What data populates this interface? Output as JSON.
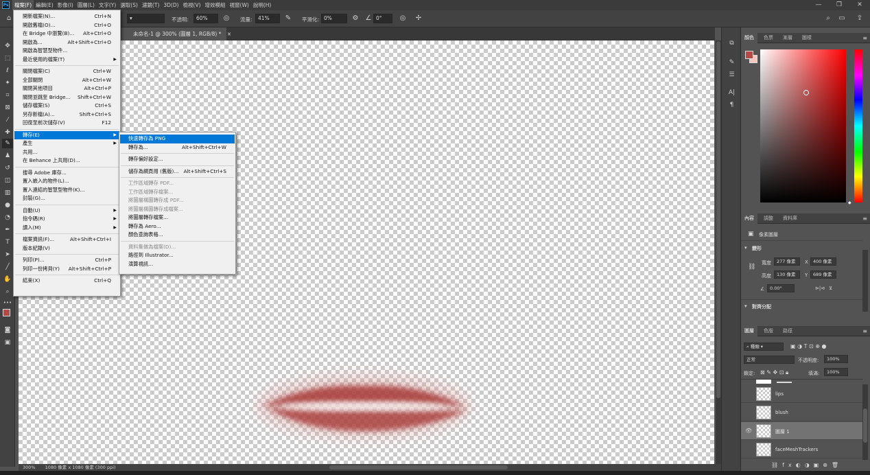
{
  "app": {
    "logo": "Ps"
  },
  "menubar": [
    {
      "label": "檔案(F)",
      "active": true
    },
    {
      "label": "編輯(E)"
    },
    {
      "label": "影像(I)"
    },
    {
      "label": "圖層(L)"
    },
    {
      "label": "文字(Y)"
    },
    {
      "label": "選取(S)"
    },
    {
      "label": "濾鏡(T)"
    },
    {
      "label": "3D(D)"
    },
    {
      "label": "檢視(V)"
    },
    {
      "label": "增效模組"
    },
    {
      "label": "視窗(W)"
    },
    {
      "label": "說明(H)"
    }
  ],
  "window_controls": {
    "minimize": "—",
    "restore": "❐",
    "close": "✕"
  },
  "options": {
    "opacity_label": "不透明:",
    "opacity_value": "60%",
    "flow_label": "流量:",
    "flow_value": "41%",
    "smoothing_label": "平滑化:",
    "smoothing_value": "0%",
    "angle_value": "0°"
  },
  "document": {
    "tab_title": "未命名-1 @ 300% (圖層 1, RGB/8) *",
    "close": "×"
  },
  "status": {
    "zoom": "300%",
    "size": "1080 像素 x 1080 像素 (300 ppi)"
  },
  "color_panel": {
    "tabs": [
      "顏色",
      "色票",
      "漸層",
      "圖樣"
    ],
    "foreground": "#b34a45",
    "background": "#f5c5bf"
  },
  "properties_panel": {
    "tabs": [
      "內容",
      "調整",
      "資料庫"
    ],
    "layer_type": "像素圖層",
    "transform_title": "變形",
    "w_label": "寬度",
    "w_value": "277 像素",
    "h_label": "高度",
    "h_value": "130 像素",
    "x_label": "X",
    "x_value": "400 像素",
    "y_label": "Y",
    "y_value": "689 像素",
    "angle_value": "0.00°",
    "align_title": "對齊分配"
  },
  "layers_panel": {
    "tabs": [
      "圖層",
      "色版",
      "路徑"
    ],
    "filter_kind": "種類",
    "blend_mode": "正常",
    "opacity_label": "不透明度:",
    "opacity_value": "100%",
    "lock_label": "鎖定:",
    "fill_label": "填滿:",
    "fill_value": "100%",
    "layers": [
      {
        "name": "lips",
        "visible": false,
        "selected": false
      },
      {
        "name": "blush",
        "visible": false,
        "selected": false
      },
      {
        "name": "圖層 1",
        "visible": true,
        "selected": true
      },
      {
        "name": "faceMeshTrackers",
        "visible": false,
        "selected": false
      }
    ]
  },
  "file_menu": [
    {
      "label": "開新檔案(N)...",
      "shortcut": "Ctrl+N"
    },
    {
      "label": "開啟舊檔(O)...",
      "shortcut": "Ctrl+O"
    },
    {
      "label": "在 Bridge 中瀏覽(B)...",
      "shortcut": "Alt+Ctrl+O"
    },
    {
      "label": "開啟為...",
      "shortcut": "Alt+Shift+Ctrl+O"
    },
    {
      "label": "開啟為智慧型物件..."
    },
    {
      "label": "最近使用的檔案(T)",
      "submenu": true
    },
    {
      "sep": true
    },
    {
      "label": "關閉檔案(C)",
      "shortcut": "Ctrl+W"
    },
    {
      "label": "全部關閉",
      "shortcut": "Alt+Ctrl+W"
    },
    {
      "label": "關閉其他項目",
      "shortcut": "Alt+Ctrl+P"
    },
    {
      "label": "關閉並跳至 Bridge...",
      "shortcut": "Shift+Ctrl+W"
    },
    {
      "label": "儲存檔案(S)",
      "shortcut": "Ctrl+S"
    },
    {
      "label": "另存新檔(A)...",
      "shortcut": "Shift+Ctrl+S"
    },
    {
      "label": "回復至前次儲存(V)",
      "shortcut": "F12"
    },
    {
      "sep": true
    },
    {
      "label": "轉存(E)",
      "submenu": true,
      "highlight": true
    },
    {
      "label": "產生",
      "submenu": true
    },
    {
      "label": "共用..."
    },
    {
      "label": "在 Behance 上共用(D)..."
    },
    {
      "sep": true
    },
    {
      "label": "搜尋 Adobe 庫存..."
    },
    {
      "label": "置入嵌入的物件(L)..."
    },
    {
      "label": "置入連結的智慧型物件(K)..."
    },
    {
      "label": "封裝(G)..."
    },
    {
      "sep": true
    },
    {
      "label": "自動(U)",
      "submenu": true
    },
    {
      "label": "指令碼(R)",
      "submenu": true
    },
    {
      "label": "讀入(M)",
      "submenu": true
    },
    {
      "sep": true
    },
    {
      "label": "檔案資訊(F)...",
      "shortcut": "Alt+Shift+Ctrl+I"
    },
    {
      "label": "版本紀錄(V)"
    },
    {
      "sep": true
    },
    {
      "label": "列印(P)...",
      "shortcut": "Ctrl+P"
    },
    {
      "label": "列印一份拷貝(Y)",
      "shortcut": "Alt+Shift+Ctrl+P"
    },
    {
      "sep": true
    },
    {
      "label": "結束(X)",
      "shortcut": "Ctrl+Q"
    }
  ],
  "export_menu": [
    {
      "label": "快速轉存為 PNG",
      "highlight": true
    },
    {
      "label": "轉存為...",
      "shortcut": "Alt+Shift+Ctrl+W"
    },
    {
      "sep": true
    },
    {
      "label": "轉存偏好設定..."
    },
    {
      "sep": true
    },
    {
      "label": "儲存為網頁用 (舊版)...",
      "shortcut": "Alt+Shift+Ctrl+S"
    },
    {
      "sep": true
    },
    {
      "label": "工作區域轉存 PDF...",
      "disabled": true
    },
    {
      "label": "工作區域轉存檔案...",
      "disabled": true
    },
    {
      "label": "將圖層構圖轉存成 PDF...",
      "disabled": true
    },
    {
      "label": "將圖層構圖轉存成檔案...",
      "disabled": true
    },
    {
      "label": "將圖層轉存檔案..."
    },
    {
      "label": "轉存為 Aero..."
    },
    {
      "label": "顏色查詢表格..."
    },
    {
      "sep": true
    },
    {
      "label": "資料集做為檔案(D)...",
      "disabled": true
    },
    {
      "label": "路徑到 Illustrator..."
    },
    {
      "label": "演算視訊..."
    }
  ]
}
